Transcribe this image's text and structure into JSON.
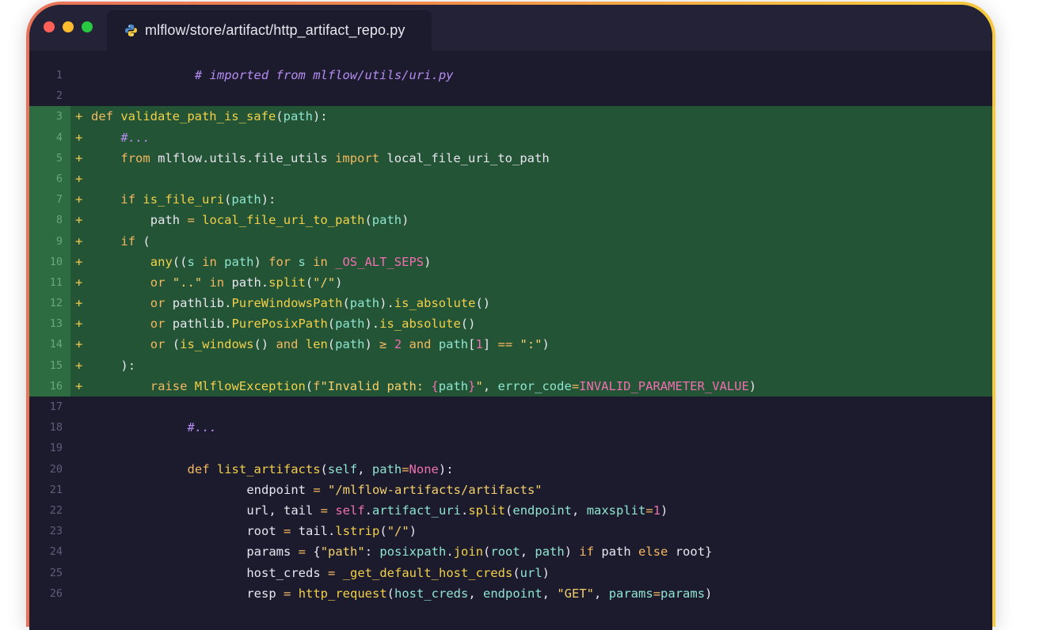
{
  "window": {
    "tab_title": "mlflow/store/artifact/http_artifact_repo.py",
    "tab_icon": "python-file-icon",
    "controls": [
      "close",
      "minimize",
      "maximize"
    ],
    "colors": {
      "close": "#fe5f57",
      "minimize": "#febc2e",
      "maximize": "#28c840",
      "editor_bg": "#1c1b2e",
      "added_line_bg": "#235435"
    }
  },
  "editor": {
    "lines": [
      {
        "n": "1",
        "added": false,
        "indent": 14,
        "tokens": [
          [
            "# imported from mlflow/utils/uri.py",
            "cmt"
          ]
        ]
      },
      {
        "n": "2",
        "added": false,
        "indent": 0,
        "tokens": []
      },
      {
        "n": "3",
        "added": true,
        "indent": 0,
        "tokens": [
          [
            "def ",
            "kw"
          ],
          [
            "validate_path_is_safe",
            "fn"
          ],
          [
            "(",
            "plain"
          ],
          [
            "path",
            "var"
          ],
          [
            "):",
            "plain"
          ]
        ]
      },
      {
        "n": "4",
        "added": true,
        "indent": 4,
        "tokens": [
          [
            "#...",
            "cmt"
          ]
        ]
      },
      {
        "n": "5",
        "added": true,
        "indent": 4,
        "tokens": [
          [
            "from ",
            "kw"
          ],
          [
            "mlflow.utils.file_utils ",
            "plain"
          ],
          [
            "import ",
            "kw"
          ],
          [
            "local_file_uri_to_path",
            "plain"
          ]
        ]
      },
      {
        "n": "6",
        "added": true,
        "indent": 0,
        "tokens": []
      },
      {
        "n": "7",
        "added": true,
        "indent": 4,
        "tokens": [
          [
            "if ",
            "kw"
          ],
          [
            "is_file_uri",
            "fn"
          ],
          [
            "(",
            "plain"
          ],
          [
            "path",
            "var"
          ],
          [
            "):",
            "plain"
          ]
        ]
      },
      {
        "n": "8",
        "added": true,
        "indent": 8,
        "tokens": [
          [
            "path ",
            "plain"
          ],
          [
            "= ",
            "op"
          ],
          [
            "local_file_uri_to_path",
            "fn"
          ],
          [
            "(",
            "plain"
          ],
          [
            "path",
            "var"
          ],
          [
            ")",
            "plain"
          ]
        ]
      },
      {
        "n": "9",
        "added": true,
        "indent": 4,
        "tokens": [
          [
            "if ",
            "kw"
          ],
          [
            "(",
            "plain"
          ]
        ]
      },
      {
        "n": "10",
        "added": true,
        "indent": 8,
        "tokens": [
          [
            "any",
            "fn"
          ],
          [
            "((",
            "plain"
          ],
          [
            "s ",
            "var"
          ],
          [
            "in ",
            "kw"
          ],
          [
            "path",
            "var"
          ],
          [
            ") ",
            "plain"
          ],
          [
            "for ",
            "kw"
          ],
          [
            "s ",
            "var"
          ],
          [
            "in ",
            "kw"
          ],
          [
            "_OS_ALT_SEPS",
            "const"
          ],
          [
            ")",
            "plain"
          ]
        ]
      },
      {
        "n": "11",
        "added": true,
        "indent": 8,
        "tokens": [
          [
            "or ",
            "kw"
          ],
          [
            "\"..\" ",
            "str"
          ],
          [
            "in ",
            "kw"
          ],
          [
            "path",
            "plain"
          ],
          [
            ".",
            "plain"
          ],
          [
            "split",
            "fn"
          ],
          [
            "(",
            "plain"
          ],
          [
            "\"/\"",
            "str"
          ],
          [
            ")",
            "plain"
          ]
        ]
      },
      {
        "n": "12",
        "added": true,
        "indent": 8,
        "tokens": [
          [
            "or ",
            "kw"
          ],
          [
            "pathlib",
            "plain"
          ],
          [
            ".",
            "plain"
          ],
          [
            "PureWindowsPath",
            "fn"
          ],
          [
            "(",
            "plain"
          ],
          [
            "path",
            "var"
          ],
          [
            ").",
            "plain"
          ],
          [
            "is_absolute",
            "fn"
          ],
          [
            "()",
            "plain"
          ]
        ]
      },
      {
        "n": "13",
        "added": true,
        "indent": 8,
        "tokens": [
          [
            "or ",
            "kw"
          ],
          [
            "pathlib",
            "plain"
          ],
          [
            ".",
            "plain"
          ],
          [
            "PurePosixPath",
            "fn"
          ],
          [
            "(",
            "plain"
          ],
          [
            "path",
            "var"
          ],
          [
            ").",
            "plain"
          ],
          [
            "is_absolute",
            "fn"
          ],
          [
            "()",
            "plain"
          ]
        ]
      },
      {
        "n": "14",
        "added": true,
        "indent": 8,
        "tokens": [
          [
            "or ",
            "kw"
          ],
          [
            "(",
            "plain"
          ],
          [
            "is_windows",
            "fn"
          ],
          [
            "() ",
            "plain"
          ],
          [
            "and ",
            "kw"
          ],
          [
            "len",
            "fn"
          ],
          [
            "(",
            "plain"
          ],
          [
            "path",
            "var"
          ],
          [
            ") ",
            "plain"
          ],
          [
            "≥ ",
            "op"
          ],
          [
            "2 ",
            "num"
          ],
          [
            "and ",
            "kw"
          ],
          [
            "path",
            "var"
          ],
          [
            "[",
            "plain"
          ],
          [
            "1",
            "num"
          ],
          [
            "] ",
            "plain"
          ],
          [
            "== ",
            "op"
          ],
          [
            "\":\"",
            "str"
          ],
          [
            ")",
            "plain"
          ]
        ]
      },
      {
        "n": "15",
        "added": true,
        "indent": 4,
        "tokens": [
          [
            "):",
            "plain"
          ]
        ]
      },
      {
        "n": "16",
        "added": true,
        "indent": 8,
        "tokens": [
          [
            "raise ",
            "kw"
          ],
          [
            "MlflowException",
            "fn"
          ],
          [
            "(",
            "plain"
          ],
          [
            "f",
            "kw"
          ],
          [
            "\"Invalid path: ",
            "str"
          ],
          [
            "{",
            "const"
          ],
          [
            "path",
            "var"
          ],
          [
            "}",
            "const"
          ],
          [
            "\"",
            "str"
          ],
          [
            ", ",
            "plain"
          ],
          [
            "error_code",
            "var"
          ],
          [
            "=",
            "op"
          ],
          [
            "INVALID_PARAMETER_VALUE",
            "const"
          ],
          [
            ")",
            "plain"
          ]
        ]
      },
      {
        "n": "17",
        "added": false,
        "indent": 0,
        "tokens": []
      },
      {
        "n": "18",
        "added": false,
        "indent": 13,
        "tokens": [
          [
            "#...",
            "cmt"
          ]
        ]
      },
      {
        "n": "19",
        "added": false,
        "indent": 0,
        "tokens": []
      },
      {
        "n": "20",
        "added": false,
        "indent": 13,
        "tokens": [
          [
            "def ",
            "kw"
          ],
          [
            "list_artifacts",
            "fn"
          ],
          [
            "(",
            "plain"
          ],
          [
            "self",
            "var"
          ],
          [
            ", ",
            "plain"
          ],
          [
            "path",
            "var"
          ],
          [
            "=",
            "op"
          ],
          [
            "None",
            "const"
          ],
          [
            "):",
            "plain"
          ]
        ]
      },
      {
        "n": "21",
        "added": false,
        "indent": 21,
        "tokens": [
          [
            "endpoint ",
            "plain"
          ],
          [
            "= ",
            "op"
          ],
          [
            "\"/mlflow-artifacts/artifacts\"",
            "str"
          ]
        ]
      },
      {
        "n": "22",
        "added": false,
        "indent": 21,
        "tokens": [
          [
            "url, tail ",
            "plain"
          ],
          [
            "= ",
            "op"
          ],
          [
            "self",
            "const"
          ],
          [
            ".",
            "plain"
          ],
          [
            "artifact_uri",
            "var"
          ],
          [
            ".",
            "plain"
          ],
          [
            "split",
            "fn"
          ],
          [
            "(",
            "plain"
          ],
          [
            "endpoint",
            "var"
          ],
          [
            ", ",
            "plain"
          ],
          [
            "maxsplit",
            "var"
          ],
          [
            "=",
            "op"
          ],
          [
            "1",
            "num"
          ],
          [
            ")",
            "plain"
          ]
        ]
      },
      {
        "n": "23",
        "added": false,
        "indent": 21,
        "tokens": [
          [
            "root ",
            "plain"
          ],
          [
            "= ",
            "op"
          ],
          [
            "tail",
            "plain"
          ],
          [
            ".",
            "plain"
          ],
          [
            "lstrip",
            "fn"
          ],
          [
            "(",
            "plain"
          ],
          [
            "\"/\"",
            "str"
          ],
          [
            ")",
            "plain"
          ]
        ]
      },
      {
        "n": "24",
        "added": false,
        "indent": 21,
        "tokens": [
          [
            "params ",
            "plain"
          ],
          [
            "= ",
            "op"
          ],
          [
            "{",
            "plain"
          ],
          [
            "\"path\"",
            "str"
          ],
          [
            ": ",
            "plain"
          ],
          [
            "posixpath",
            "var"
          ],
          [
            ".",
            "plain"
          ],
          [
            "join",
            "fn"
          ],
          [
            "(",
            "plain"
          ],
          [
            "root",
            "var"
          ],
          [
            ", ",
            "plain"
          ],
          [
            "path",
            "var"
          ],
          [
            ") ",
            "plain"
          ],
          [
            "if ",
            "kw"
          ],
          [
            "path ",
            "plain"
          ],
          [
            "else ",
            "kw"
          ],
          [
            "root",
            "plain"
          ],
          [
            "}",
            "plain"
          ]
        ]
      },
      {
        "n": "25",
        "added": false,
        "indent": 21,
        "tokens": [
          [
            "host_creds ",
            "plain"
          ],
          [
            "= ",
            "op"
          ],
          [
            "_get_default_host_creds",
            "fn"
          ],
          [
            "(",
            "plain"
          ],
          [
            "url",
            "var"
          ],
          [
            ")",
            "plain"
          ]
        ]
      },
      {
        "n": "26",
        "added": false,
        "indent": 21,
        "tokens": [
          [
            "resp ",
            "plain"
          ],
          [
            "= ",
            "op"
          ],
          [
            "http_request",
            "fn"
          ],
          [
            "(",
            "plain"
          ],
          [
            "host_creds",
            "var"
          ],
          [
            ", ",
            "plain"
          ],
          [
            "endpoint",
            "var"
          ],
          [
            ", ",
            "plain"
          ],
          [
            "\"GET\"",
            "str"
          ],
          [
            ", ",
            "plain"
          ],
          [
            "params",
            "var"
          ],
          [
            "=",
            "op"
          ],
          [
            "params",
            "var"
          ],
          [
            ")",
            "plain"
          ]
        ]
      }
    ]
  }
}
